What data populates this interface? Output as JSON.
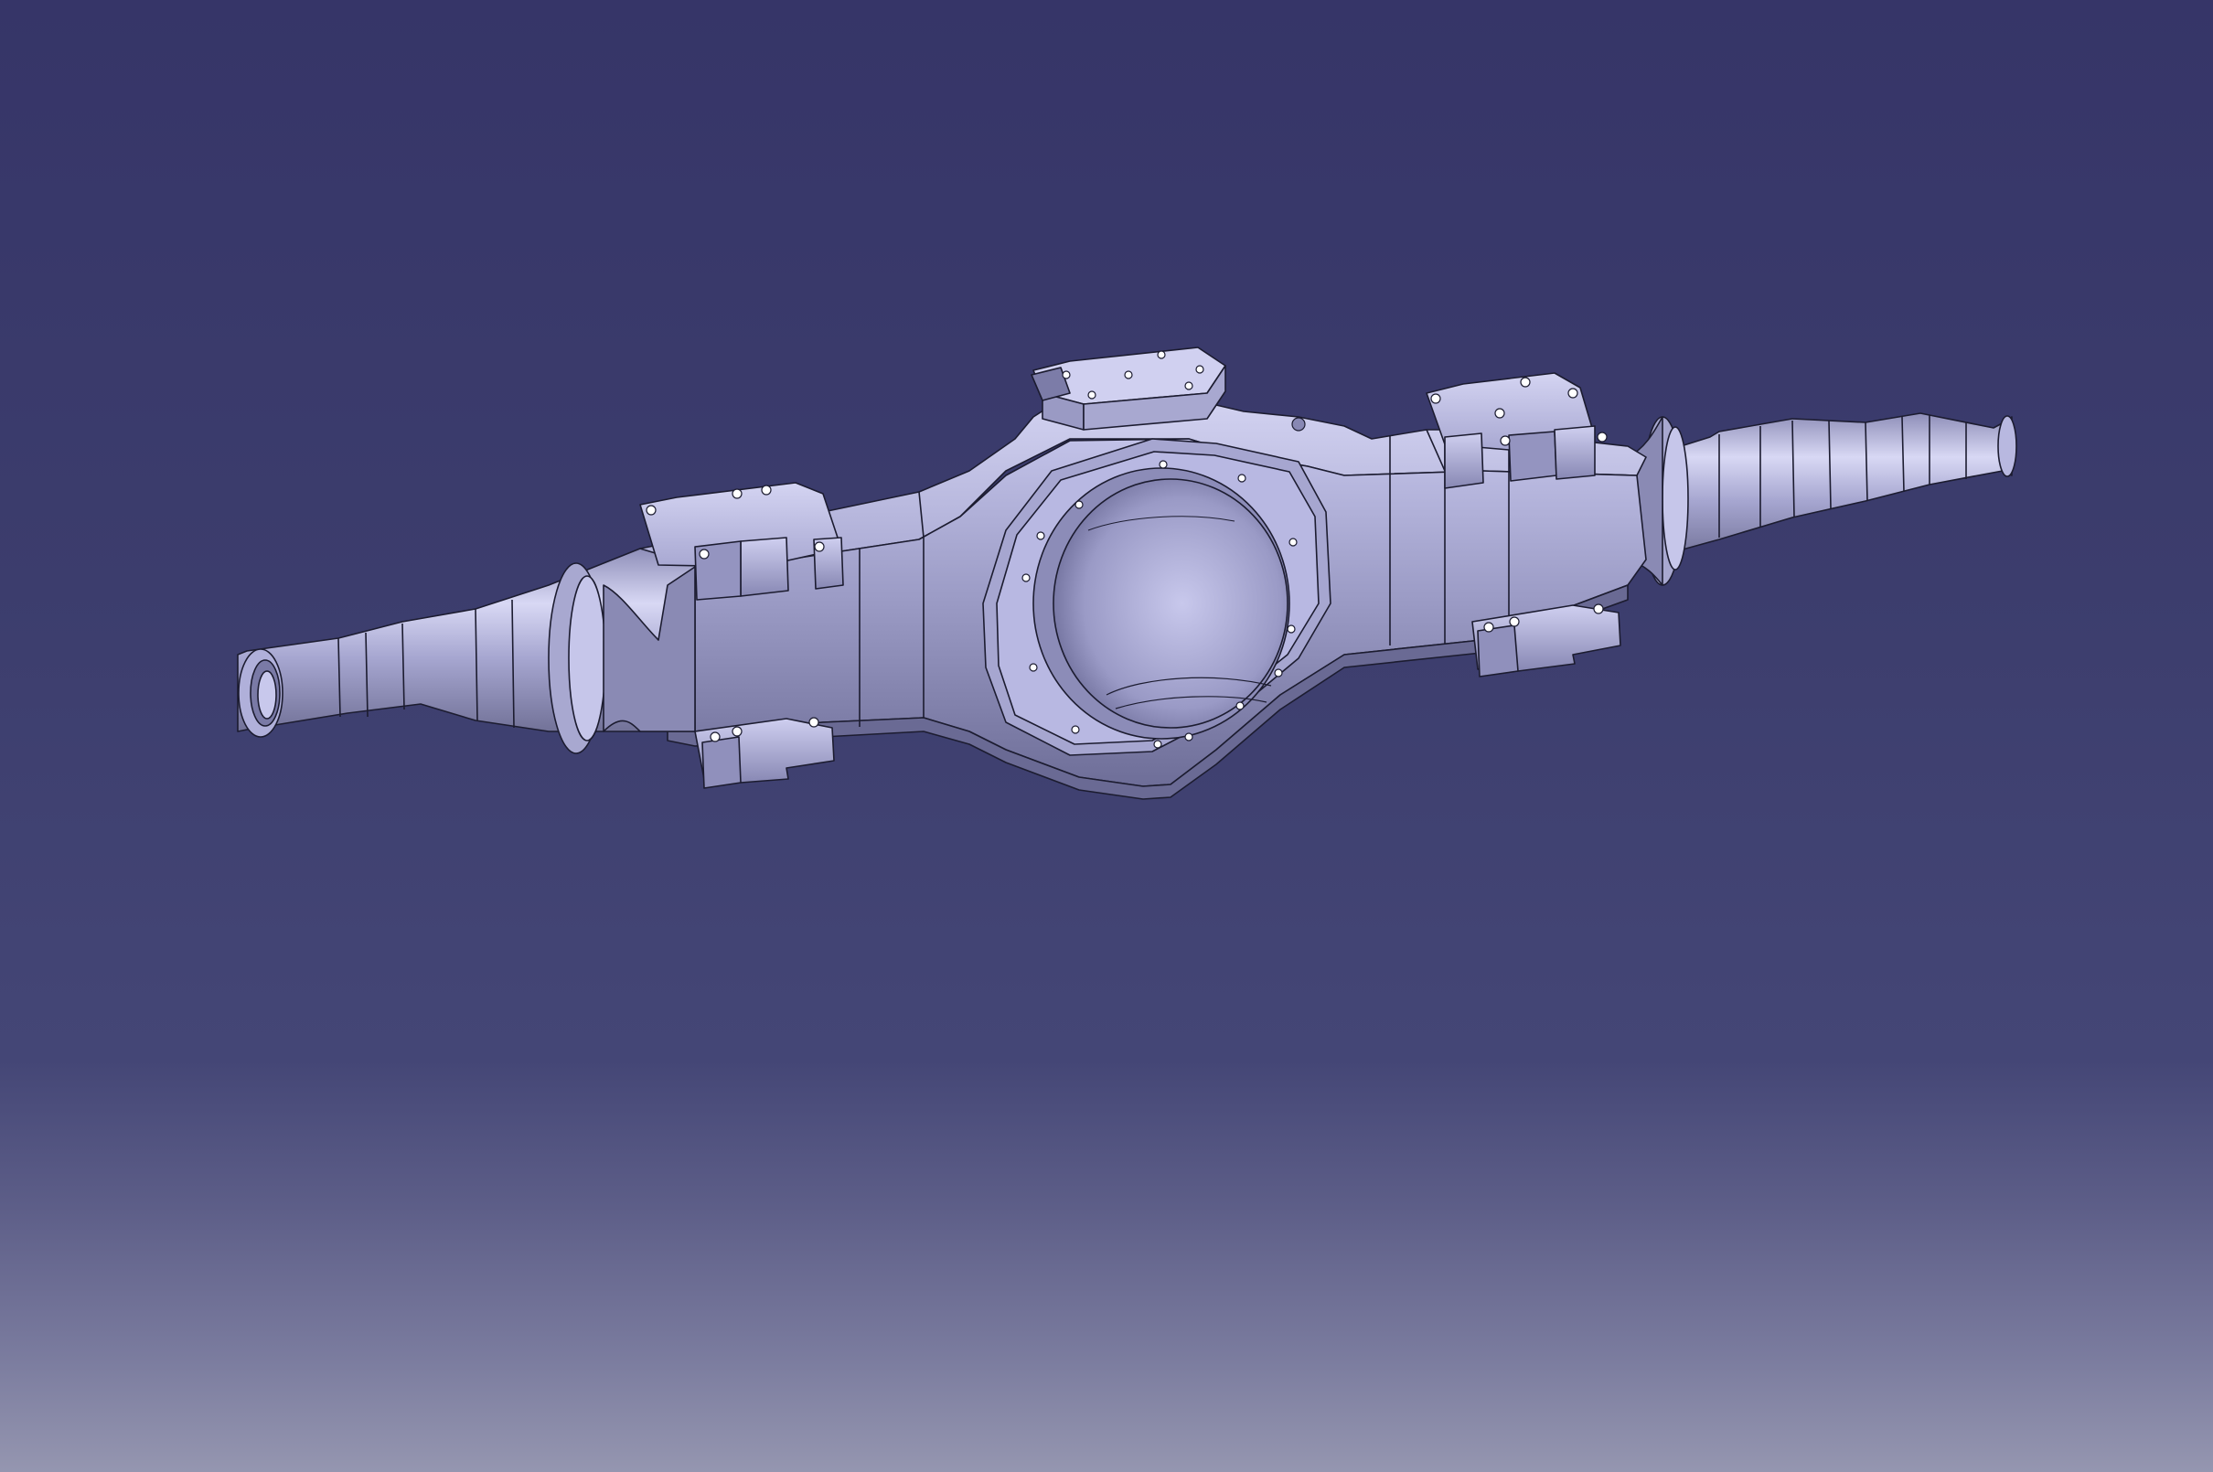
{
  "viewport": {
    "background_top": "#363568",
    "background_mid": "#444676",
    "background_bottom": "#9596b0"
  },
  "model": {
    "part": "axle-housing",
    "face_light": "#c4c4ea",
    "face_mid": "#a4a4cc",
    "face_dark": "#7c7ca8",
    "edge": "#1c1c30"
  }
}
